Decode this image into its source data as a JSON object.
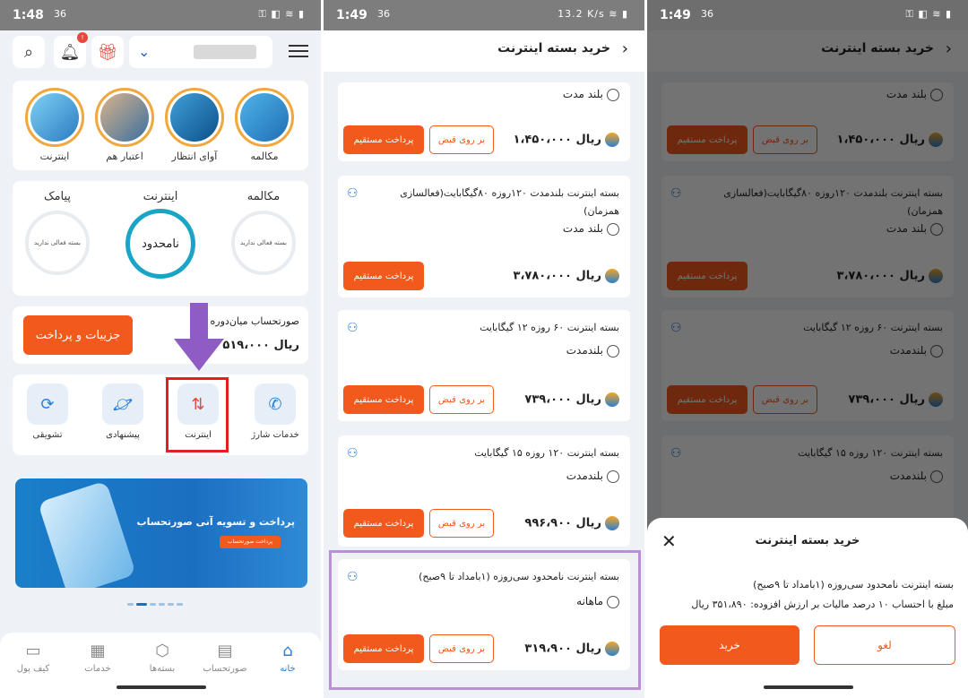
{
  "status": {
    "p1_time": "1:48",
    "p2_time": "1:49",
    "p3_time": "1:49",
    "net_label": "36",
    "speed_label": "13.2 K/s"
  },
  "home": {
    "stories": [
      {
        "label": "مکالمه"
      },
      {
        "label": "آوای انتظار"
      },
      {
        "label": "اعتبار هم"
      },
      {
        "label": "اینترنت"
      }
    ],
    "usage": {
      "call_title": "مکالمه",
      "call_status": "بسته فعالی ندارید",
      "internet_title": "اینترنت",
      "internet_status": "نامحدود",
      "sms_title": "پیامک",
      "sms_status": "بسته فعالی ندارید"
    },
    "bill": {
      "label": "صورتحساب میان‌دوره",
      "amount": "۵۱۹،۰۰۰ ریال",
      "button": "جزییات و پرداخت"
    },
    "services": [
      {
        "label": "خدمات شارژ",
        "icon": "phone-icon"
      },
      {
        "label": "اینترنت",
        "icon": "internet-icon"
      },
      {
        "label": "پیشنهادی",
        "icon": "planet-icon"
      },
      {
        "label": "تشویقی",
        "icon": "refresh-icon"
      }
    ],
    "banner": {
      "title": "پرداخت و تسویه آنی صورتحساب",
      "button": "پرداخت صورتحساب"
    },
    "nav": [
      {
        "label": "خانه",
        "icon": "home-icon"
      },
      {
        "label": "صورتحساب",
        "icon": "bill-icon"
      },
      {
        "label": "بسته‌ها",
        "icon": "box-icon"
      },
      {
        "label": "خدمات",
        "icon": "grid-icon"
      },
      {
        "label": "کیف پول",
        "icon": "wallet-icon"
      }
    ]
  },
  "packages": {
    "title": "خرید بسته اینترنت",
    "direct_label": "پرداخت مستقیم",
    "onbill_label": "بر روی قبض",
    "items": [
      {
        "name": "",
        "duration": "بلند مدت",
        "price": "۱،۴۵۰،۰۰۰ ریال"
      },
      {
        "name": "بسته اینترنت بلندمدت ۱۲۰روزه ۸۰گیگابایت(فعالسازی همزمان)",
        "duration": "بلند مدت",
        "price": "۳،۷۸۰،۰۰۰ ریال"
      },
      {
        "name": "بسته اینترنت  ۶۰ روزه ۱۲ گیگابایت",
        "duration": "بلندمدت",
        "price": "۷۳۹،۰۰۰ ریال"
      },
      {
        "name": "بسته اینترنت  ۱۲۰ روزه ۱۵ گیگابایت",
        "duration": "بلندمدت",
        "price": "۹۹۶،۹۰۰ ریال"
      },
      {
        "name": "بسته اینترنت نامحدود سی‌روزه (۱بامداد تا ۹صبح)",
        "duration": "ماهانه",
        "price": "۳۱۹،۹۰۰ ریال"
      }
    ]
  },
  "sheet": {
    "title": "خرید بسته اینترنت",
    "line1": "بسته اینترنت نامحدود سی‌روزه (۱بامداد تا ۹صبح)",
    "line2": "مبلغ با احتساب ۱۰ درصد مالیات بر ارزش افزوده: ۳۵۱،۸۹۰  ریال",
    "buy": "خرید",
    "cancel": "لغو"
  }
}
